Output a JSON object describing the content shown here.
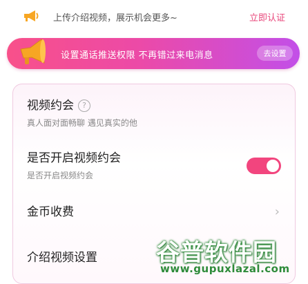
{
  "header": {
    "tip": "上传介绍视频，展示机会更多~",
    "verify_link": "立即认证"
  },
  "push_banner": {
    "message": "设置通话推送权限  不再错过来电消息",
    "button": "去设置"
  },
  "settings": {
    "video_date": {
      "title": "视频约会",
      "help": "?",
      "subtitle": "真人面对面畅聊 遇见真实的他"
    },
    "enable_video_date": {
      "title": "是否开启视频约会",
      "subtitle": "是否开启视频约会",
      "enabled": true
    },
    "coin_fee": {
      "title": "金币收费",
      "chevron": "›"
    },
    "intro_video": {
      "title": "介绍视频设置"
    }
  },
  "watermark": {
    "title": "谷普软件园",
    "url": "www.gupuxlazal.com"
  },
  "colors": {
    "accent": "#f2457e",
    "link": "#e8457a",
    "banner_start": "#f8508a",
    "banner_end": "#c24fe8"
  }
}
